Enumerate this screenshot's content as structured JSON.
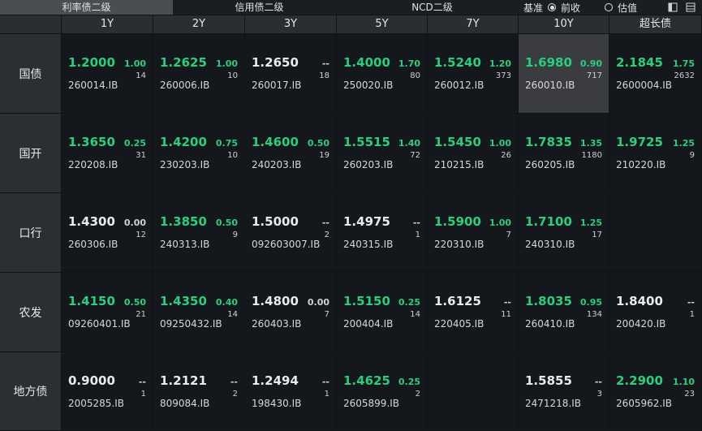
{
  "tabs": [
    {
      "label": "利率债二级",
      "active": true
    },
    {
      "label": "信用债二级",
      "active": false
    },
    {
      "label": "NCD二级",
      "active": false
    }
  ],
  "controls": {
    "basis_label": "基准",
    "opt_prev_label": "前收",
    "opt_est_label": "估值",
    "selected": "前收"
  },
  "icons": [
    "layout-icon",
    "grid-icon"
  ],
  "columns": [
    "1Y",
    "2Y",
    "3Y",
    "5Y",
    "7Y",
    "10Y",
    "超长债"
  ],
  "rows": [
    {
      "label": "国债",
      "cells": [
        {
          "price": "1.2000",
          "chg": "1.00",
          "cnt": "14",
          "code": "260014.IB",
          "dir": "up"
        },
        {
          "price": "1.2625",
          "chg": "1.00",
          "cnt": "10",
          "code": "260006.IB",
          "dir": "up"
        },
        {
          "price": "1.2650",
          "chg": "--",
          "cnt": "18",
          "code": "260017.IB",
          "dir": "flat"
        },
        {
          "price": "1.4000",
          "chg": "1.70",
          "cnt": "80",
          "code": "250020.IB",
          "dir": "up"
        },
        {
          "price": "1.5240",
          "chg": "1.20",
          "cnt": "373",
          "code": "260012.IB",
          "dir": "up"
        },
        {
          "price": "1.6980",
          "chg": "0.90",
          "cnt": "717",
          "code": "260010.IB",
          "dir": "up",
          "selected": true
        },
        {
          "price": "2.1845",
          "chg": "1.75",
          "cnt": "2632",
          "code": "2600004.IB",
          "dir": "up"
        }
      ]
    },
    {
      "label": "国开",
      "cells": [
        {
          "price": "1.3650",
          "chg": "0.25",
          "cnt": "31",
          "code": "220208.IB",
          "dir": "up"
        },
        {
          "price": "1.4200",
          "chg": "0.75",
          "cnt": "10",
          "code": "230203.IB",
          "dir": "up"
        },
        {
          "price": "1.4600",
          "chg": "0.50",
          "cnt": "19",
          "code": "240203.IB",
          "dir": "up"
        },
        {
          "price": "1.5515",
          "chg": "1.40",
          "cnt": "72",
          "code": "260203.IB",
          "dir": "up"
        },
        {
          "price": "1.5450",
          "chg": "1.00",
          "cnt": "26",
          "code": "210215.IB",
          "dir": "up"
        },
        {
          "price": "1.7835",
          "chg": "1.35",
          "cnt": "1180",
          "code": "260205.IB",
          "dir": "up"
        },
        {
          "price": "1.9725",
          "chg": "1.25",
          "cnt": "9",
          "code": "210220.IB",
          "dir": "up"
        }
      ]
    },
    {
      "label": "口行",
      "cells": [
        {
          "price": "1.4300",
          "chg": "0.00",
          "cnt": "12",
          "code": "260306.IB",
          "dir": "flat"
        },
        {
          "price": "1.3850",
          "chg": "0.50",
          "cnt": "9",
          "code": "240313.IB",
          "dir": "up"
        },
        {
          "price": "1.5000",
          "chg": "--",
          "cnt": "2",
          "code": "092603007.IB",
          "dir": "flat"
        },
        {
          "price": "1.4975",
          "chg": "--",
          "cnt": "1",
          "code": "240315.IB",
          "dir": "flat"
        },
        {
          "price": "1.5900",
          "chg": "1.00",
          "cnt": "7",
          "code": "220310.IB",
          "dir": "up"
        },
        {
          "price": "1.7100",
          "chg": "1.25",
          "cnt": "17",
          "code": "240310.IB",
          "dir": "up"
        },
        null
      ]
    },
    {
      "label": "农发",
      "cells": [
        {
          "price": "1.4150",
          "chg": "0.50",
          "cnt": "21",
          "code": "09260401.IB",
          "dir": "up"
        },
        {
          "price": "1.4350",
          "chg": "0.40",
          "cnt": "14",
          "code": "09250432.IB",
          "dir": "up"
        },
        {
          "price": "1.4800",
          "chg": "0.00",
          "cnt": "7",
          "code": "260403.IB",
          "dir": "flat"
        },
        {
          "price": "1.5150",
          "chg": "0.25",
          "cnt": "14",
          "code": "200404.IB",
          "dir": "up"
        },
        {
          "price": "1.6125",
          "chg": "--",
          "cnt": "11",
          "code": "220405.IB",
          "dir": "flat"
        },
        {
          "price": "1.8035",
          "chg": "0.95",
          "cnt": "134",
          "code": "260410.IB",
          "dir": "up"
        },
        {
          "price": "1.8400",
          "chg": "--",
          "cnt": "1",
          "code": "200420.IB",
          "dir": "flat"
        }
      ]
    },
    {
      "label": "地方债",
      "cells": [
        {
          "price": "0.9000",
          "chg": "--",
          "cnt": "1",
          "code": "2005285.IB",
          "dir": "flat"
        },
        {
          "price": "1.2121",
          "chg": "--",
          "cnt": "2",
          "code": "809084.IB",
          "dir": "flat"
        },
        {
          "price": "1.2494",
          "chg": "--",
          "cnt": "1",
          "code": "198430.IB",
          "dir": "flat"
        },
        {
          "price": "1.4625",
          "chg": "0.25",
          "cnt": "2",
          "code": "2605899.IB",
          "dir": "up"
        },
        null,
        {
          "price": "1.5855",
          "chg": "--",
          "cnt": "3",
          "code": "2471218.IB",
          "dir": "flat"
        },
        {
          "price": "2.2900",
          "chg": "1.10",
          "cnt": "23",
          "code": "2605962.IB",
          "dir": "up"
        }
      ]
    }
  ]
}
